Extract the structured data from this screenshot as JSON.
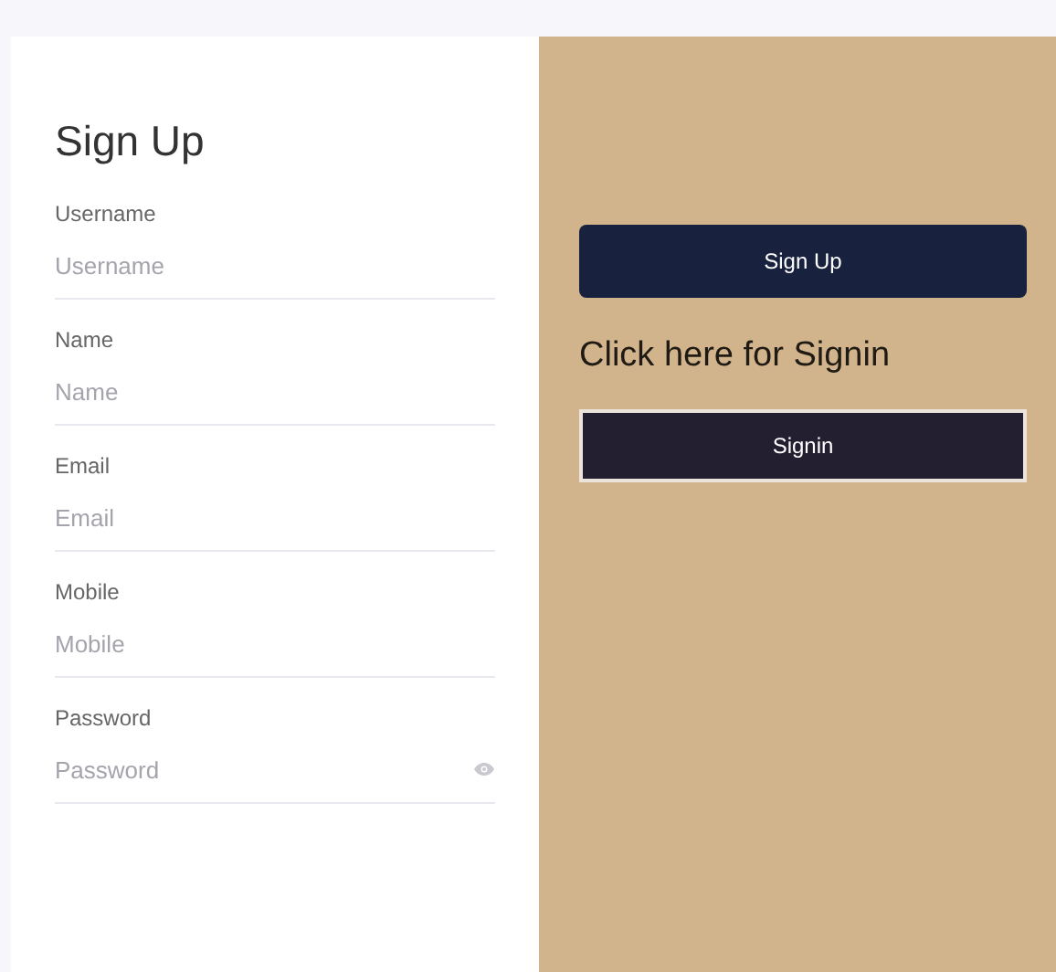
{
  "form": {
    "title": "Sign Up",
    "fields": [
      {
        "label": "Username",
        "placeholder": "Username",
        "kind": "text"
      },
      {
        "label": "Name",
        "placeholder": "Name",
        "kind": "text"
      },
      {
        "label": "Email",
        "placeholder": "Email",
        "kind": "text"
      },
      {
        "label": "Mobile",
        "placeholder": "Mobile",
        "kind": "text"
      },
      {
        "label": "Password",
        "placeholder": "Password",
        "kind": "password"
      }
    ]
  },
  "side": {
    "signup_button": "Sign Up",
    "prompt": "Click here for Signin",
    "signin_button": "Signin"
  }
}
